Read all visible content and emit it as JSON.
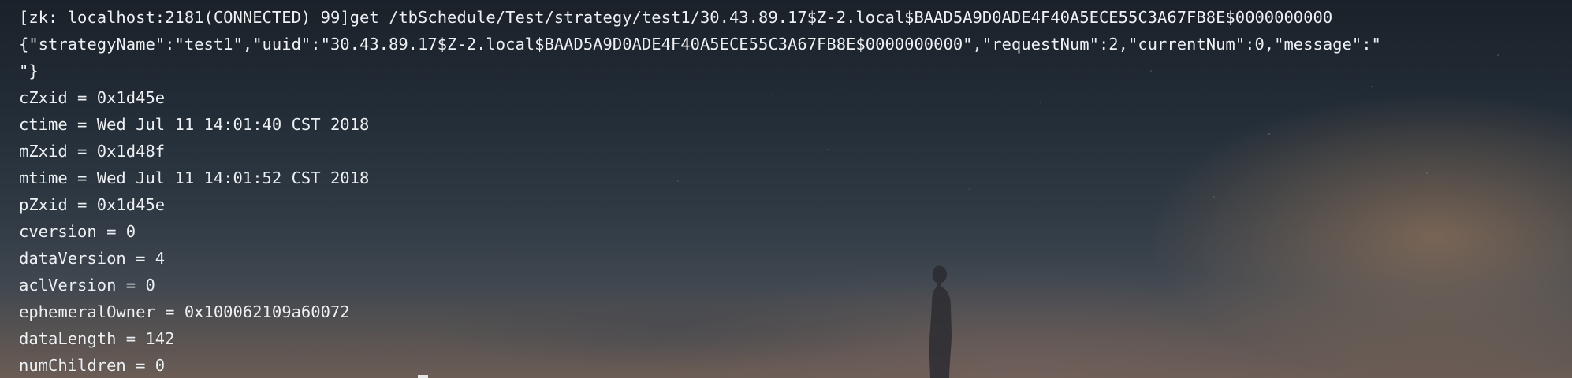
{
  "terminal": {
    "lines": [
      "[zk: localhost:2181(CONNECTED) 99]get /tbSchedule/Test/strategy/test1/30.43.89.17$Z-2.local$BAAD5A9D0ADE4F40A5ECE55C3A67FB8E$0000000000",
      "{\"strategyName\":\"test1\",\"uuid\":\"30.43.89.17$Z-2.local$BAAD5A9D0ADE4F40A5ECE55C3A67FB8E$0000000000\",\"requestNum\":2,\"currentNum\":0,\"message\":\"",
      "\"}",
      "cZxid = 0x1d45e",
      "ctime = Wed Jul 11 14:01:40 CST 2018",
      "mZxid = 0x1d48f",
      "mtime = Wed Jul 11 14:01:52 CST 2018",
      "pZxid = 0x1d45e",
      "cversion = 0",
      "dataVersion = 4",
      "aclVersion = 0",
      "ephemeralOwner = 0x100062109a60072",
      "dataLength = 142",
      "numChildren = 0"
    ]
  },
  "colors": {
    "text": "#eef1f4",
    "background_top": "#1a2129",
    "background_bottom": "#6b5c55"
  }
}
